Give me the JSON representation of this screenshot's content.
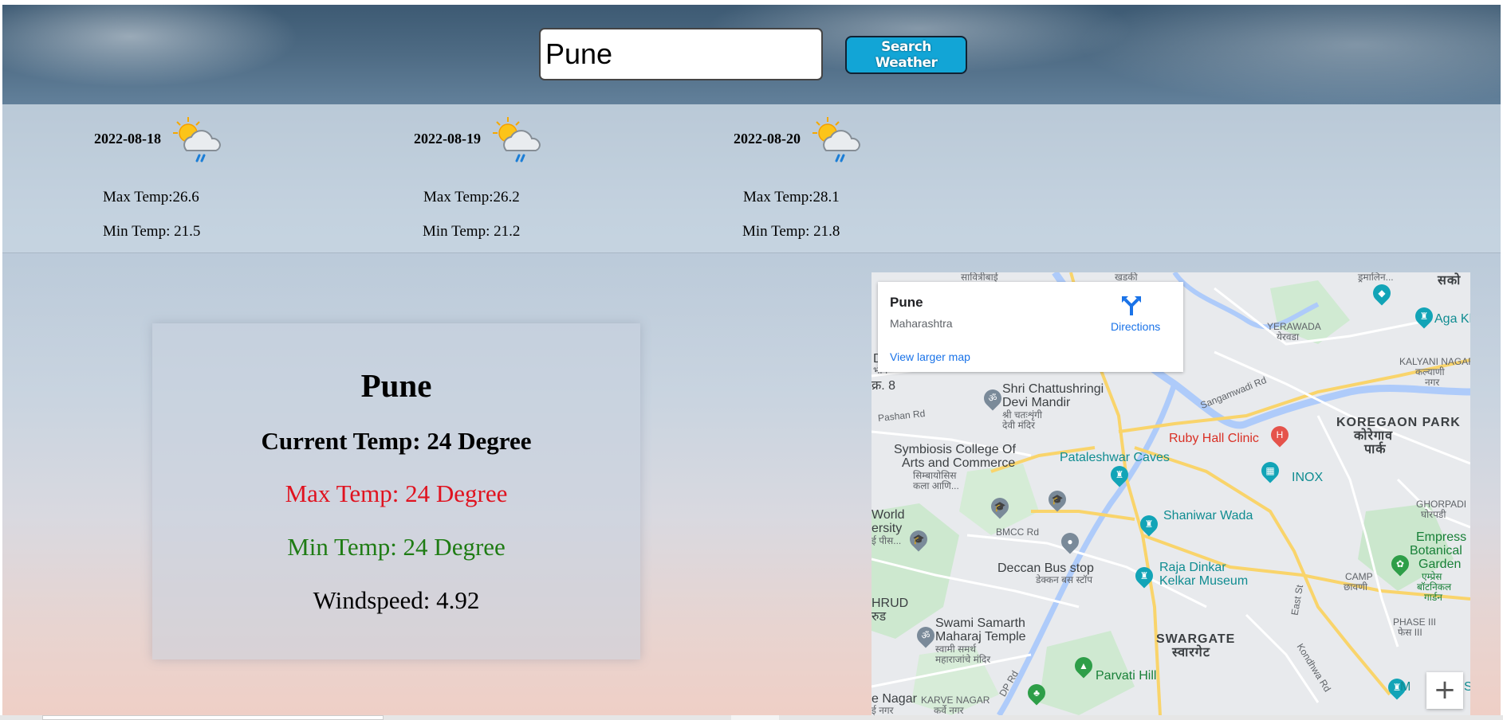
{
  "search": {
    "value": "Pune",
    "button_label": "Search Weather"
  },
  "forecast": [
    {
      "date": "2022-08-18",
      "max": "Max Temp:26.6",
      "min": "Min Temp: 21.5",
      "icon": "partly-cloudy-rain-icon"
    },
    {
      "date": "2022-08-19",
      "max": "Max Temp:26.2",
      "min": "Min Temp: 21.2",
      "icon": "partly-cloudy-rain-icon"
    },
    {
      "date": "2022-08-20",
      "max": "Max Temp:28.1",
      "min": "Min Temp: 21.8",
      "icon": "partly-cloudy-rain-icon"
    }
  ],
  "current": {
    "city": "Pune",
    "current_temp": "Current Temp: 24 Degree",
    "max_temp": "Max Temp: 24 Degree",
    "min_temp": "Min Temp: 24 Degree",
    "windspeed": "Windspeed: 4.92",
    "colors": {
      "max": "#e0121f",
      "min": "#1f7c14"
    }
  },
  "map": {
    "place_title": "Pune",
    "place_subtitle": "Maharashtra",
    "directions_label": "Directions",
    "larger_map_link": "View larger map",
    "zoom_in": "+",
    "labels": {
      "shri_chattushringi": "Shri Chattushringi",
      "devi_mandir": "Devi Mandir",
      "shri_chattushringi_mr": "श्री चतःशृंगी",
      "devi_mandir_mr": "देवी मंदिर",
      "pashan_rd": "Pashan Rd",
      "symbiosis": "Symbiosis College Of",
      "arts_commerce": "Arts and Commerce",
      "symbiosis_mr1": "सिम्बायोसिस",
      "symbiosis_mr2": "कला आणि...",
      "pataleshwar": "Pataleshwar Caves",
      "ruby_hall": "Ruby Hall Clinic",
      "inox": "INOX",
      "koregaon_park": "KOREGAON PARK",
      "koregaon_park_mr1": "कोरेगाव",
      "koregaon_park_mr2": "पार्क",
      "yerawada": "YERAWADA",
      "yerawada_mr": "येरवडा",
      "kalyani_nagar": "KALYANI NAGAR",
      "kalyani_nagar_mr1": "कल्याणी",
      "kalyani_nagar_mr2": "नगर",
      "aga_khan": "Aga Kh",
      "sangamwadi_rd": "Sangamwadi Rd",
      "shaniwar_wada": "Shaniwar Wada",
      "bmcc_rd": "BMCC Rd",
      "world": "World",
      "ersity": "ersity",
      "pees": "ई पीस...",
      "deccan": "Deccan Bus stop",
      "deccan_mr": "डेक्कन बस स्टॉप",
      "raja_dinkar": "Raja Dinkar",
      "kelkar": "Kelkar Museum",
      "ghorpadi": "GHORPADI",
      "ghorpadi_mr": "घोरपडी",
      "empress1": "Empress",
      "empress2": "Botanical",
      "empress3": "Garden",
      "empress_mr1": "एम्प्रेस",
      "empress_mr2": "बॉटनिकल",
      "empress_mr3": "गार्डन",
      "camp": "CAMP",
      "camp_mr": "छावणी",
      "east_st": "East St",
      "hrud": "HRUD",
      "hrud_mr": "रुड",
      "swami1": "Swami Samarth",
      "swami2": "Maharaj Temple",
      "swami_mr1": "स्वामी समर्थ",
      "swami_mr2": "महाराजांचे मंदिर",
      "swargate": "SWARGATE",
      "swargate_mr": "स्वारगेट",
      "phase3": "PHASE III",
      "phase3_mr": "फेस III",
      "kondhwa_rd": "Kondhwa Rd",
      "parvati": "Parvati Hill",
      "dp_rd": "DP Rd",
      "e_nagar": "e Nagar",
      "e_nagar_mr": "ई नगर",
      "karve_nagar": "KARVE NAGAR",
      "karve_nagar_mr": "कर्वे नगर",
      "d_left": "D",
      "bhag_left": "भाग",
      "kra8": "क्र. 8",
      "savitribai": "सावित्रीबाई",
      "khadki": "खडकी",
      "drumalin": "ड्रमालिन...",
      "sako": "सको",
      "m_right": "M",
      "s_right": "S"
    }
  }
}
